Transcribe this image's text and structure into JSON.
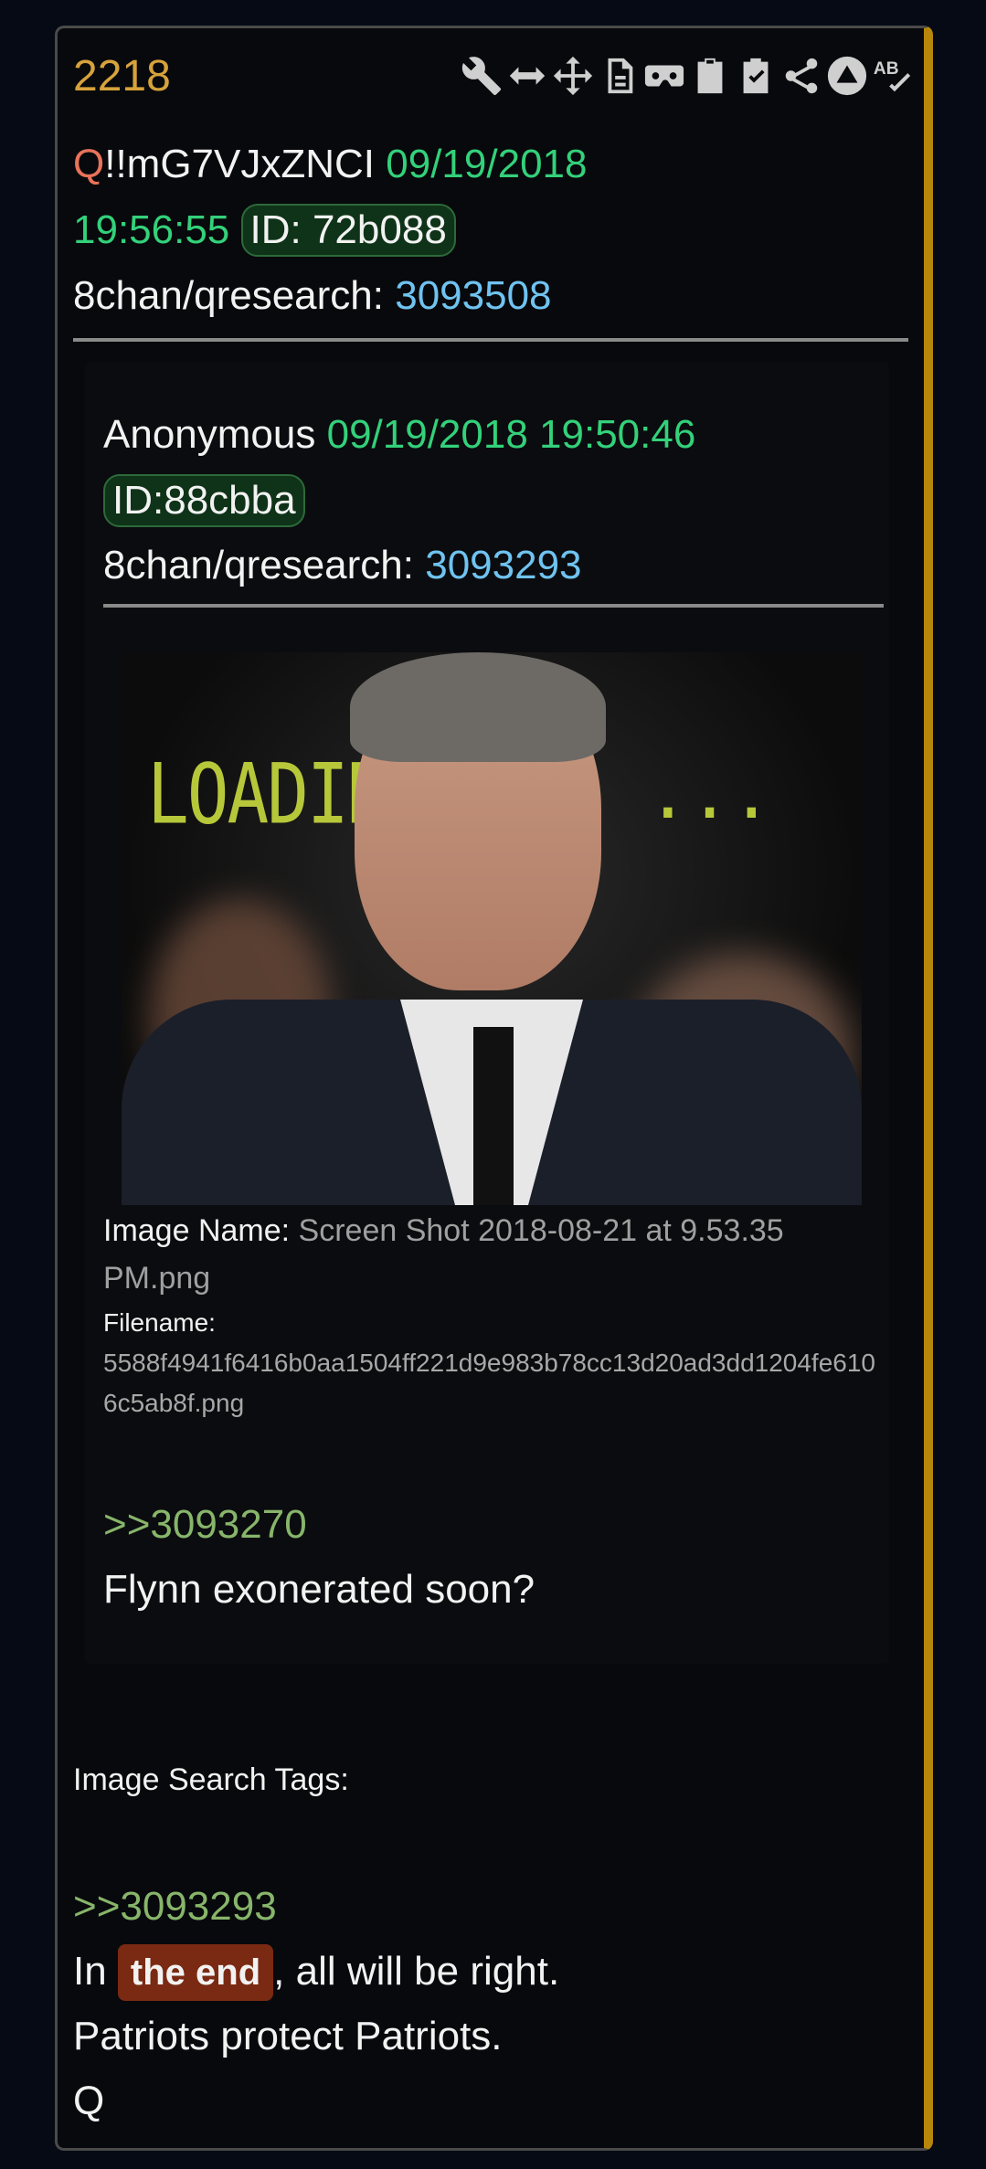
{
  "post": {
    "number": "2218",
    "author_prefix": "Q",
    "tripcode": "!!mG7VJxZNCI",
    "date": "09/19/2018",
    "time": "19:56:55",
    "id_label": "ID: 72b088",
    "board": "8chan/qresearch:",
    "post_ref": "3093508"
  },
  "toolbar": {
    "icons": [
      "wrench-icon",
      "resize-horizontal-icon",
      "move-icon",
      "document-icon",
      "vr-headset-icon",
      "clipboard-icon",
      "clipboard-check-icon",
      "share-icon",
      "triangle-circle-icon",
      "spellcheck-icon"
    ]
  },
  "quoted": {
    "author": "Anonymous",
    "datetime": "09/19/2018 19:50:46",
    "id_label": "ID:88cbba",
    "board": "8chan/qresearch:",
    "post_ref": "3093293",
    "image_text": "LOADING",
    "image_dots": "...",
    "image_name_label": "Image Name:",
    "image_name": "Screen Shot 2018-08-21 at 9.53.35 PM.png",
    "filename_label": "Filename:",
    "filename": "5588f4941f6416b0aa1504ff221d9e983b78cc13d20ad3dd1204fe6106c5ab8f.png",
    "reply_ref": ">>3093270",
    "body": "Flynn exonerated soon?"
  },
  "tags_label": "Image Search Tags:",
  "body": {
    "reply_ref": ">>3093293",
    "line1_pre": "In ",
    "line1_highlight": "the end",
    "line1_post": ", all will be right.",
    "line2": "Patriots protect Patriots.",
    "line3": "Q"
  },
  "colors": {
    "accent_border": "#b8860b",
    "post_number": "#d6a23b",
    "date_green": "#33d17a",
    "ref_blue": "#6fc3f0",
    "reply_green": "#87b56a",
    "highlight": "#7a2a12"
  }
}
